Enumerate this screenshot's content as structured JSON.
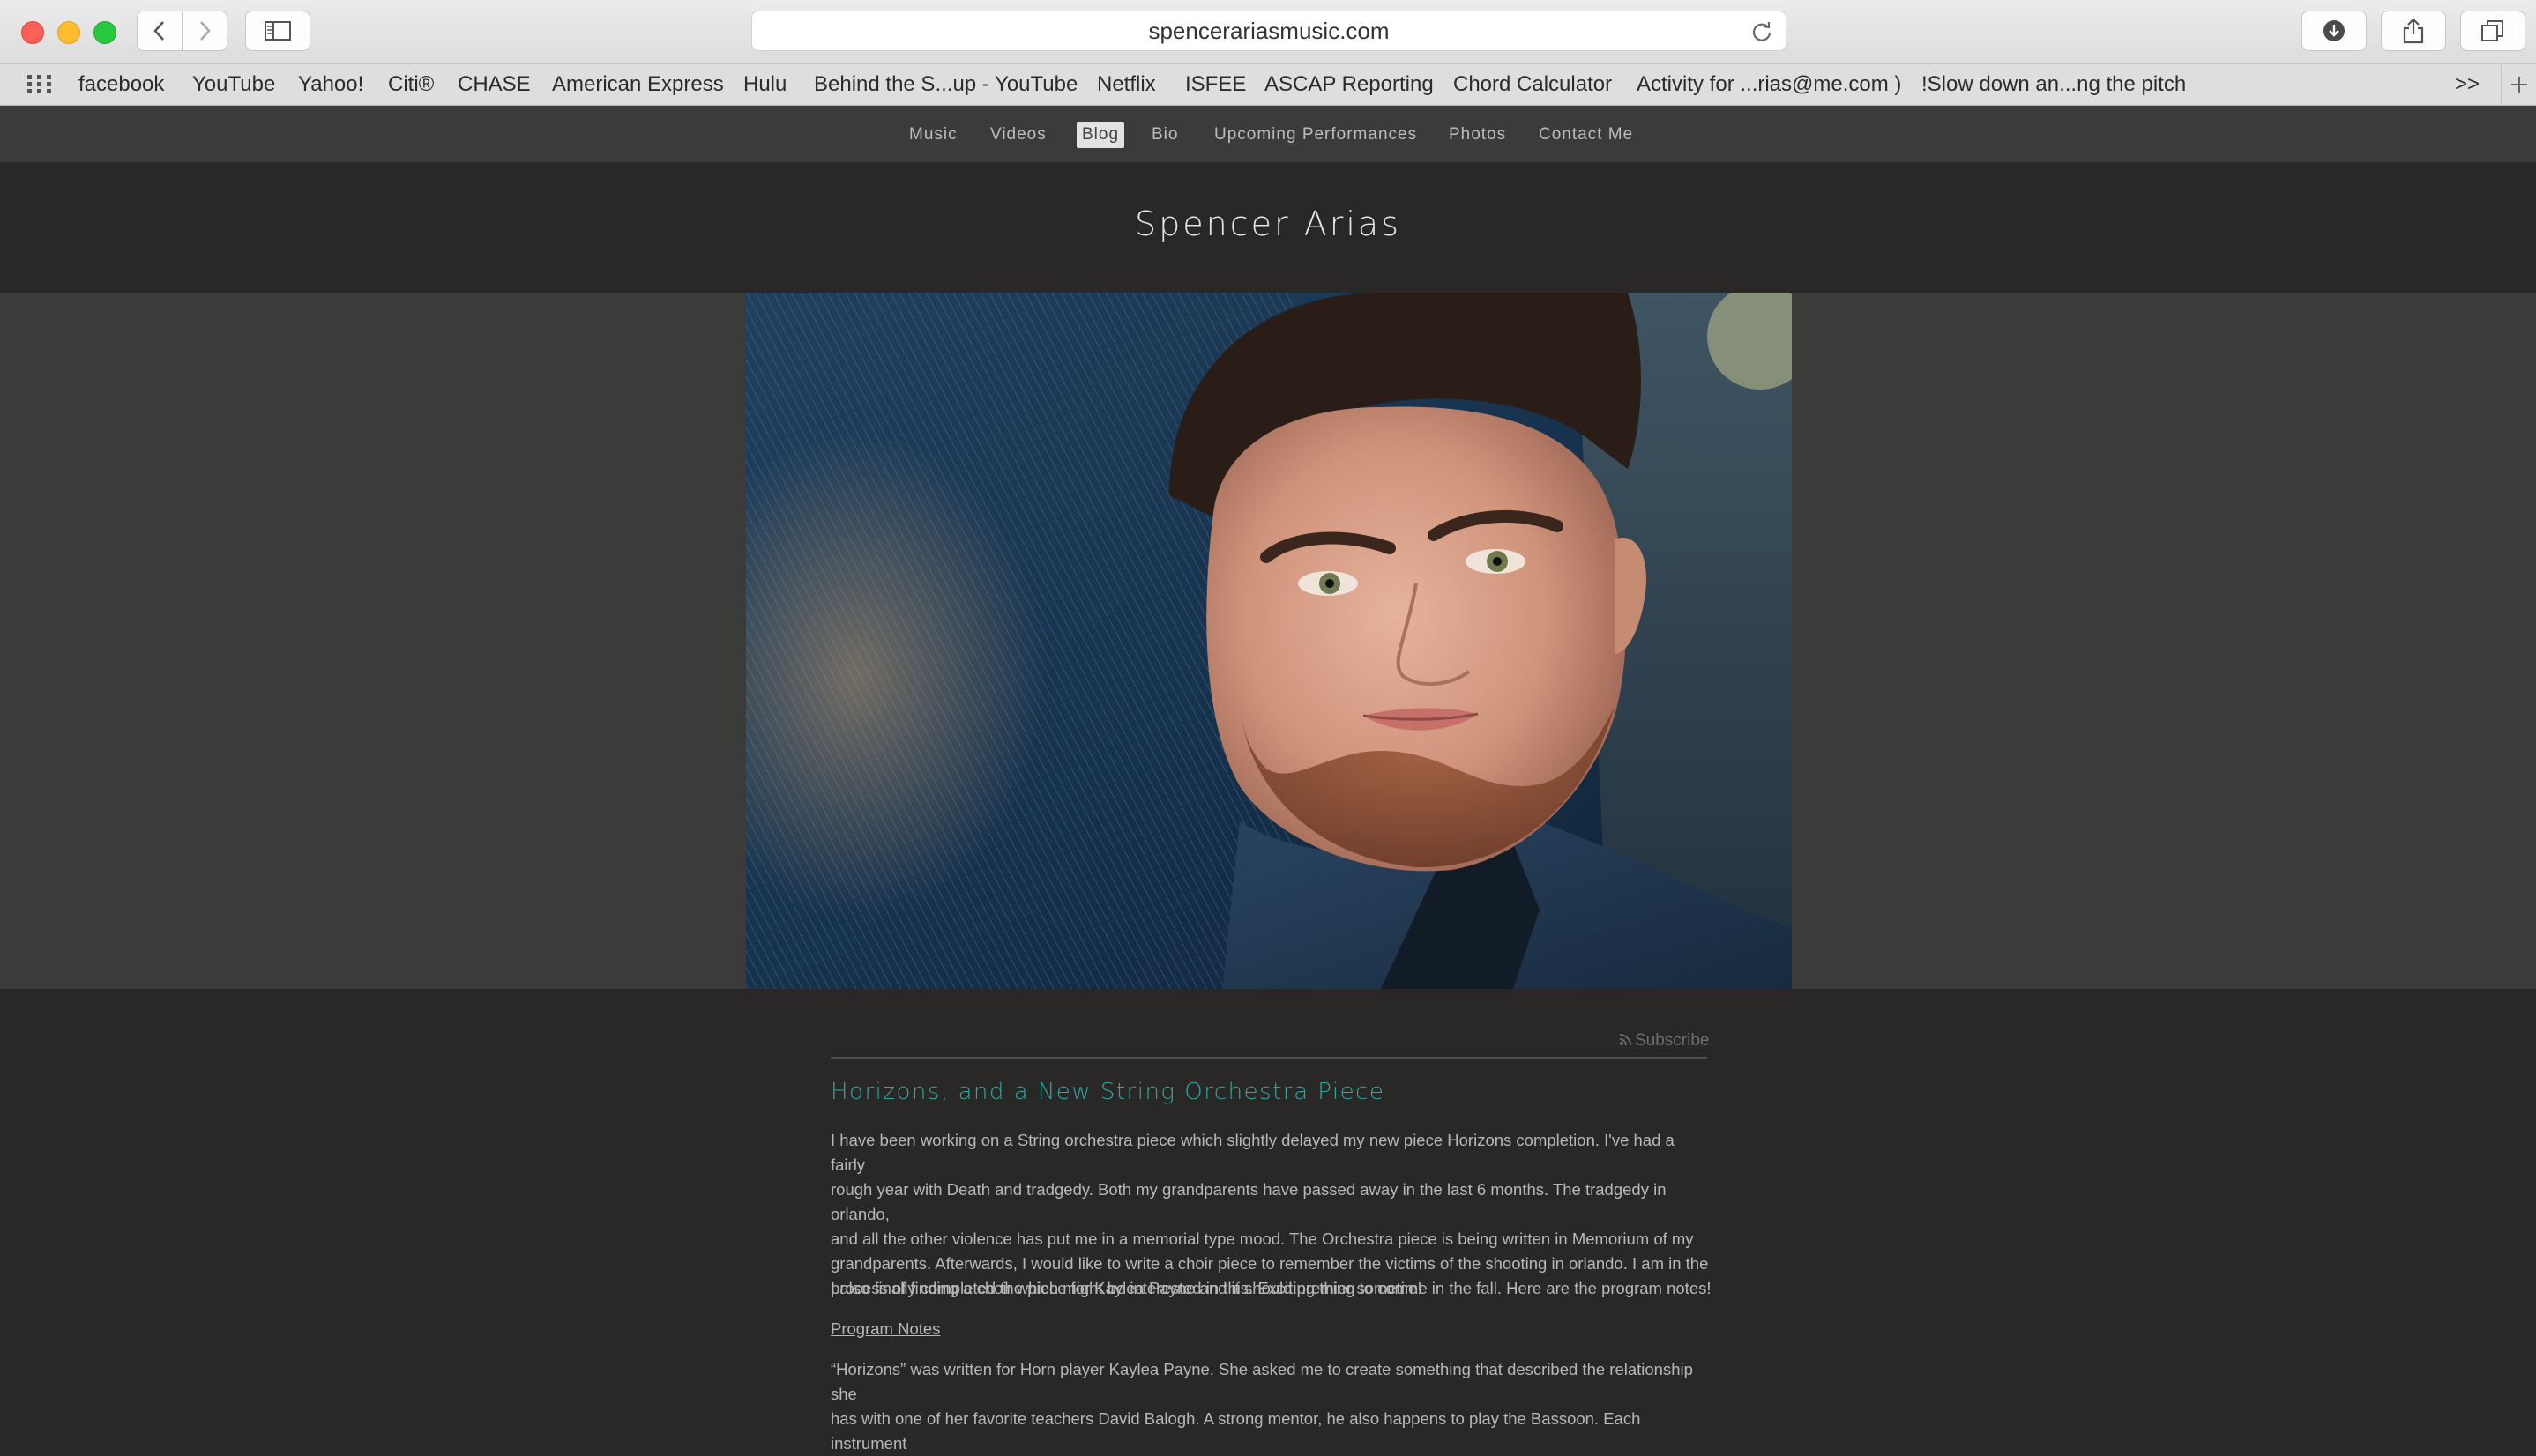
{
  "browser": {
    "url": "spencerariasmusic.com",
    "favorites": [
      "facebook",
      "YouTube",
      "Yahoo!",
      "Citi®",
      "CHASE",
      "American Express",
      "Hulu",
      "Behind the S...up - YouTube",
      "Netflix",
      "ISFEE",
      "ASCAP Reporting",
      "Chord Calculator",
      "Activity for ...rias@me.com )",
      "!Slow down an...ng the pitch"
    ],
    "more_label": ">>"
  },
  "site": {
    "nav": [
      "Music",
      "Videos",
      "Blog",
      "Bio",
      "Upcoming Performances",
      "Photos",
      "Contact Me"
    ],
    "active_nav": "Blog",
    "title": "Spencer Arias",
    "accent_color": "#2fa8a0"
  },
  "post": {
    "subscribe": "Subscribe",
    "title": "Horizons, and a New String Orchestra Piece",
    "paragraph1_lines": [
      "I have been working on a String orchestra piece which slightly delayed my new piece Horizons completion. I've had a fairly",
      "rough year with Death and tradgedy. Both my grandparents have passed away in the last 6 months. The tradgedy in orlando,",
      "and all the other violence has put me in a memorial type mood. The Orchestra piece is being written in Memorium of my",
      "grandparents. Afterwards, I would like to write a choir piece to remember the victims of the shooting in orlando. I am in the",
      "process of finding a choir which might be interested in this. Exciting thing to come!"
    ],
    "paragraph2": "I also finally completed the piece for Kaylea Payne and it should premier sometime in the fall. Here are the program notes!",
    "program_notes_link": "Program Notes",
    "paragraph3_lines": [
      "“Horizons” was written for Horn player Kaylea Payne. She asked me to create something that described the relationship she",
      "has with one of her favorite teachers David Balogh. A strong mentor, he also happens to play the Bassoon. Each instrument"
    ]
  },
  "icons": {
    "back": "chevron-left-icon",
    "forward": "chevron-right-icon",
    "sidebar": "sidebar-icon",
    "reload": "reload-icon",
    "download": "download-icon",
    "share": "share-icon",
    "tabs": "tabs-overview-icon",
    "grid": "grid-icon",
    "rss": "rss-icon"
  }
}
